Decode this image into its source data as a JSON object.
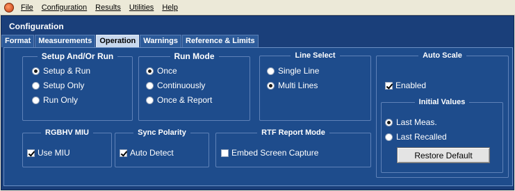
{
  "menu": {
    "items": [
      {
        "label": "File"
      },
      {
        "label": "Configuration"
      },
      {
        "label": "Results"
      },
      {
        "label": "Utilities"
      },
      {
        "label": "Help"
      }
    ]
  },
  "title": "Configuration",
  "tabs": [
    {
      "label": "Format"
    },
    {
      "label": "Measurements"
    },
    {
      "label": "Operation",
      "active": true
    },
    {
      "label": "Warnings"
    },
    {
      "label": "Reference & Limits"
    }
  ],
  "setup": {
    "legend": "Setup And/Or Run",
    "options": [
      "Setup & Run",
      "Setup Only",
      "Run Only"
    ],
    "selected": "Setup & Run"
  },
  "run_mode": {
    "legend": "Run Mode",
    "options": [
      "Once",
      "Continuously",
      "Once & Report"
    ],
    "selected": "Once"
  },
  "line_select": {
    "legend": "Line Select",
    "options": [
      "Single Line",
      "Multi Lines"
    ],
    "selected": "Multi Lines"
  },
  "auto_scale": {
    "legend": "Auto Scale",
    "enabled_label": "Enabled",
    "enabled": true,
    "initial_values": {
      "legend": "Initial Values",
      "options": [
        "Last Meas.",
        "Last Recalled"
      ],
      "selected": "Last Meas."
    },
    "restore_label": "Restore Default"
  },
  "rgbhv": {
    "legend": "RGBHV MIU",
    "check_label": "Use MIU",
    "checked": true
  },
  "sync": {
    "legend": "Sync Polarity",
    "check_label": "Auto Detect",
    "checked": true
  },
  "rtf": {
    "legend": "RTF Report Mode",
    "check_label": "Embed Screen Capture",
    "checked": false
  }
}
